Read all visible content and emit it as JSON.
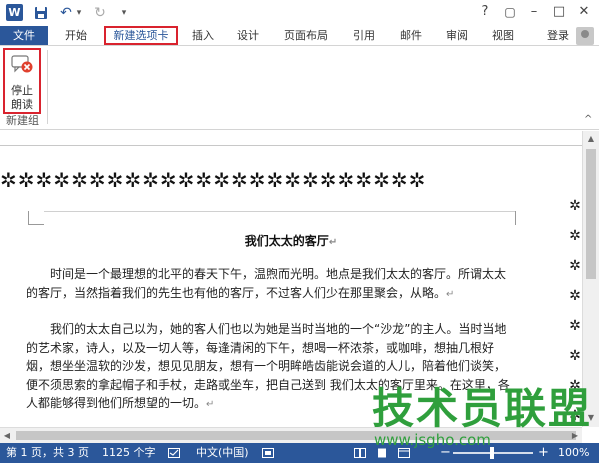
{
  "window": {
    "app_icon_letter": "W",
    "help_glyph": "?",
    "restore_glyph": "▢",
    "minimize_glyph": "–",
    "maximize_glyph": "□",
    "close_glyph": "✕"
  },
  "quick_access": {
    "save_icon": "floppy-disk",
    "undo_glyph": "↶",
    "redo_glyph": "↻",
    "customize_glyph": "▾"
  },
  "tabs": [
    {
      "label": "文件"
    },
    {
      "label": "开始"
    },
    {
      "label": "新建选项卡"
    },
    {
      "label": "插入"
    },
    {
      "label": "设计"
    },
    {
      "label": "页面布局"
    },
    {
      "label": "引用"
    },
    {
      "label": "邮件"
    },
    {
      "label": "审阅"
    },
    {
      "label": "视图"
    }
  ],
  "active_tab_index": 2,
  "account": {
    "login_label": "登录"
  },
  "ribbon": {
    "stop_reading": {
      "line1": "停止",
      "line2": "朗读"
    },
    "group_label": "新建组",
    "collapse_glyph": "^"
  },
  "document": {
    "border_glyph": "✲",
    "title": "我们太太的客厅",
    "paragraph_1": "时间是一个最理想的北平的春天下午，温煦而光明。地点是我们太太的客厅。所谓太太的客厅，当然指着我们的先生也有他的客厅，不过客人们少在那里聚会，从略。",
    "paragraph_2": "我们的太太自己以为，她的客人们也以为她是当时当地的一个“沙龙”的主人。当时当地的艺术家，诗人，以及一切人等，每逢清闲的下午，想喝一杯浓茶，或咖啡，想抽几根好烟，想坐坐温软的沙发，想见见朋友，想有一个明眸皓齿能说会道的人儿，陪着他们谈笑，便不须思索的拿起帽子和手杖，走路或坐车，把自己送到 我们太太的客厅里来。在这里，各人都能够得到他们所想望的一切。",
    "paragraph_mark": "↵"
  },
  "scrollbars": {
    "up": "▲",
    "down": "▼",
    "left": "◀",
    "right": "▶"
  },
  "status": {
    "page": "第 1 页，共 3 页",
    "words": "1125 个字",
    "language": "中文(中国)",
    "zoom_minus": "−",
    "zoom_plus": "+",
    "zoom": "100%"
  },
  "watermark": {
    "text": "技术员联盟",
    "url": "www.jsgho.com"
  },
  "colors": {
    "brand": "#2b579a",
    "highlight": "#d9232e",
    "watermark": "#2f9f3c"
  }
}
